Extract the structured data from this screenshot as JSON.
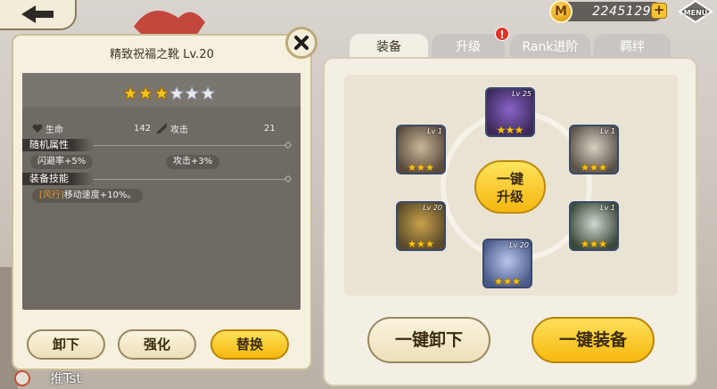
{
  "currency": {
    "amount": "2245129",
    "plus": "+",
    "coin_symbol": "M"
  },
  "menu": {
    "label": "MENU"
  },
  "item": {
    "title": "精致祝福之靴 Lv.20",
    "stars_filled": 3,
    "stars_total": 6,
    "stats": [
      {
        "label": "生命",
        "value": "142",
        "icon": "heart-icon"
      },
      {
        "label": "攻击",
        "value": "21",
        "icon": "sword-icon"
      }
    ],
    "random_attr_header": "随机属性",
    "random_attrs": [
      "闪避率+5%",
      "攻击+3%"
    ],
    "skill_header": "装备技能",
    "skill_tag": "[风行]",
    "skill_text": "移动速度+10%。"
  },
  "detail_buttons": {
    "unequip": "卸下",
    "enhance": "强化",
    "replace": "替换"
  },
  "character": {
    "name": "推Tst"
  },
  "tabs": [
    {
      "label": "装备",
      "active": true
    },
    {
      "label": "升级",
      "active": false,
      "alert": "!"
    },
    {
      "label": "Rank进阶",
      "active": false
    },
    {
      "label": "羁绊",
      "active": false
    }
  ],
  "equipment_slots": [
    {
      "id": "top",
      "level": "Lv 25",
      "stars": 3
    },
    {
      "id": "left-upper",
      "level": "Lv 1",
      "stars": 3
    },
    {
      "id": "right-upper",
      "level": "Lv 1",
      "stars": 3
    },
    {
      "id": "left-lower",
      "level": "Lv 20",
      "stars": 3
    },
    {
      "id": "right-lower",
      "level": "Lv 1",
      "stars": 3
    },
    {
      "id": "bottom",
      "level": "Lv 20",
      "stars": 3
    }
  ],
  "center_button": {
    "line1": "一键",
    "line2": "升级"
  },
  "bottom_buttons": {
    "unequip_all": "一键卸下",
    "equip_all": "一键装备"
  },
  "colors": {
    "accent_yellow": "#f5b70f",
    "panel_cream": "#f6f0de",
    "star_gold": "#f3c21a"
  }
}
